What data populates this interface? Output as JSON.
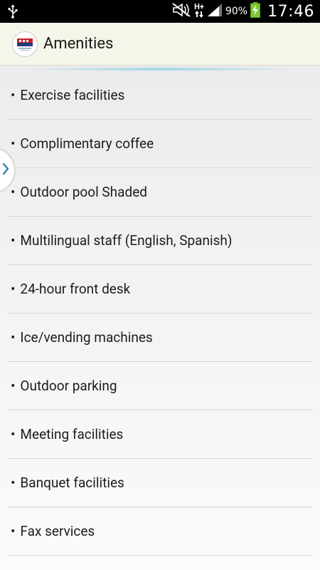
{
  "status_bar": {
    "time": "17:46",
    "battery_percent": "90%",
    "network_type": "H+",
    "icons": [
      "usb-icon",
      "mute-icon",
      "network-type-icon",
      "signal-icon",
      "battery-charging-icon"
    ]
  },
  "action_bar": {
    "title": "Amenities",
    "logo_icon": "hotel-logo-icon"
  },
  "amenities": [
    {
      "label": "Exercise facilities"
    },
    {
      "label": "Complimentary coffee"
    },
    {
      "label": "Outdoor pool Shaded"
    },
    {
      "label": "Multilingual staff (English, Spanish)"
    },
    {
      "label": "24-hour front desk"
    },
    {
      "label": "Ice/vending machines"
    },
    {
      "label": "Outdoor parking"
    },
    {
      "label": "Meeting facilities"
    },
    {
      "label": "Banquet facilities"
    },
    {
      "label": "Fax services"
    }
  ],
  "colors": {
    "status_bar": "#000000",
    "action_bar": "#f6f5ea",
    "accent_glow": "#78c8e1",
    "drawer_chevron": "#2e7fb0",
    "battery": "#7cc832"
  }
}
